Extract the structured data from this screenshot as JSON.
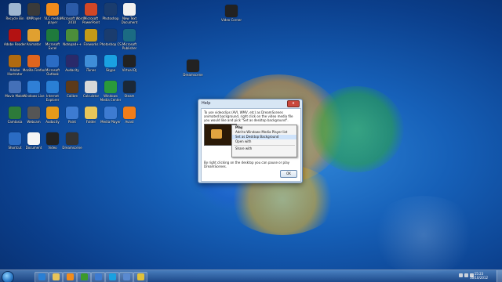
{
  "colors": {
    "accent": "#1660b8",
    "dialog_bg": "#d7e6f4"
  },
  "desktop": {
    "icons": [
      {
        "label": "Recycle Bin",
        "icon": "recycle-bin-icon",
        "color": "#9fb7d0"
      },
      {
        "label": "KMPlayer",
        "icon": "kmplayer-icon",
        "color": "#3a3a3a"
      },
      {
        "label": "VLC media player",
        "icon": "vlc-icon",
        "color": "#f28c1b"
      },
      {
        "label": "Microsoft Word 2010",
        "icon": "word-icon",
        "color": "#2b5ba8"
      },
      {
        "label": "Microsoft PowerPoint",
        "icon": "powerpoint-icon",
        "color": "#d24726"
      },
      {
        "label": "Photoshop",
        "icon": "photoshop-icon",
        "color": "#1a3c6e"
      },
      {
        "label": "New Text Document",
        "icon": "text-document-icon",
        "color": "#f1f1f1"
      },
      {
        "label": "Adobe Reader",
        "icon": "adobe-reader-icon",
        "color": "#b31212"
      },
      {
        "label": "Animator",
        "icon": "animator-icon",
        "color": "#e0a030"
      },
      {
        "label": "Microsoft Excel",
        "icon": "excel-icon",
        "color": "#1f7a3c"
      },
      {
        "label": "Notepad++",
        "icon": "notepad-icon",
        "color": "#4c8d3a"
      },
      {
        "label": "Fireworks",
        "icon": "fireworks-icon",
        "color": "#c49a18"
      },
      {
        "label": "Photoshop CS",
        "icon": "photoshop-icon",
        "color": "#1a3c6e"
      },
      {
        "label": "Microsoft Publisher",
        "icon": "publisher-icon",
        "color": "#1b6b83"
      },
      {
        "label": "Adobe Illustrator",
        "icon": "illustrator-icon",
        "color": "#b06a10"
      },
      {
        "label": "Mozilla Firefox",
        "icon": "firefox-icon",
        "color": "#e0651e"
      },
      {
        "label": "Microsoft Outlook",
        "icon": "outlook-icon",
        "color": "#2b6cc4"
      },
      {
        "label": "Audacity",
        "icon": "audacity-icon",
        "color": "#2a2a6a"
      },
      {
        "label": "iTunes",
        "icon": "itunes-icon",
        "color": "#3f8ed8"
      },
      {
        "label": "Skype",
        "icon": "skype-icon",
        "color": "#1aa1e1"
      },
      {
        "label": "Virtual DJ",
        "icon": "virtualdj-icon",
        "color": "#222"
      },
      {
        "label": "Movie Maker",
        "icon": "movie-maker-icon",
        "color": "#4470b8"
      },
      {
        "label": "Windows Live",
        "icon": "windows-live-icon",
        "color": "#2f7fd6"
      },
      {
        "label": "Internet Explorer",
        "icon": "ie-icon",
        "color": "#2a7fd4"
      },
      {
        "label": "Calibre",
        "icon": "calibre-icon",
        "color": "#5c3a1a"
      },
      {
        "label": "Calculator",
        "icon": "calculator-icon",
        "color": "#d8d8d8"
      },
      {
        "label": "Windows Media Center",
        "icon": "media-center-icon",
        "color": "#2a9a3a"
      },
      {
        "label": "Steam",
        "icon": "steam-icon",
        "color": "#1b2838"
      },
      {
        "label": "Camtasia",
        "icon": "camtasia-icon",
        "color": "#2d7a3a"
      },
      {
        "label": "Webcam",
        "icon": "webcam-icon",
        "color": "#555"
      },
      {
        "label": "Audacity",
        "icon": "headphones-icon",
        "color": "#e59a1a"
      },
      {
        "label": "Paint",
        "icon": "paint-icon",
        "color": "#3d7bd1"
      },
      {
        "label": "Folder",
        "icon": "folder-icon",
        "color": "#e8c55a"
      },
      {
        "label": "Media Player",
        "icon": "media-player-icon",
        "color": "#3d7bd1"
      },
      {
        "label": "Avast",
        "icon": "avast-icon",
        "color": "#f07d1a"
      },
      {
        "label": "Shortcut",
        "icon": "shortcut-icon",
        "color": "#2b6cc4"
      },
      {
        "label": "Document",
        "icon": "document-icon",
        "color": "#f5f5f5"
      },
      {
        "label": "Video",
        "icon": "video-icon",
        "color": "#222"
      },
      {
        "label": "Dreamscene",
        "icon": "dreamscene-icon",
        "color": "#333"
      }
    ],
    "lone_icons": [
      {
        "label": "Video Corner",
        "icon": "video-corner-icon",
        "color": "#222"
      },
      {
        "label": "Dreamscene",
        "icon": "dreamscene-icon",
        "color": "#222"
      }
    ]
  },
  "dialog": {
    "title": "Help",
    "close_label": "x",
    "message": "To use videoclips (AVI, WMV, etc) as DreamScenes animated background, right click on the video media file you would like and pick \"Set as desktop background\".",
    "context_menu": {
      "items": [
        "Play",
        "Add to Windows Media Player list",
        "Set as Desktop Background",
        "Open with",
        "Share with"
      ]
    },
    "hint": "By right clicking on the desktop you can pause or play DreamScenes.",
    "ok_label": "OK"
  },
  "taskbar": {
    "items": [
      {
        "name": "ie",
        "icon": "ie-icon",
        "color": "#2a7fd4"
      },
      {
        "name": "explorer",
        "icon": "folder-icon",
        "color": "#e8c55a"
      },
      {
        "name": "media-player",
        "icon": "media-player-icon",
        "color": "#f28c1b"
      },
      {
        "name": "utorrent",
        "icon": "utorrent-icon",
        "color": "#3c9a2c"
      },
      {
        "name": "windows-live",
        "icon": "windows-live-icon",
        "color": "#3d7bd1"
      },
      {
        "name": "skype",
        "icon": "skype-icon",
        "color": "#1aa1e1"
      },
      {
        "name": "paint",
        "icon": "paint-icon",
        "color": "#5a8ad0"
      },
      {
        "name": "chrome",
        "icon": "chrome-icon",
        "color": "#e0c13a"
      }
    ],
    "clock_time": "15:23",
    "clock_date": "16/10/2012"
  }
}
